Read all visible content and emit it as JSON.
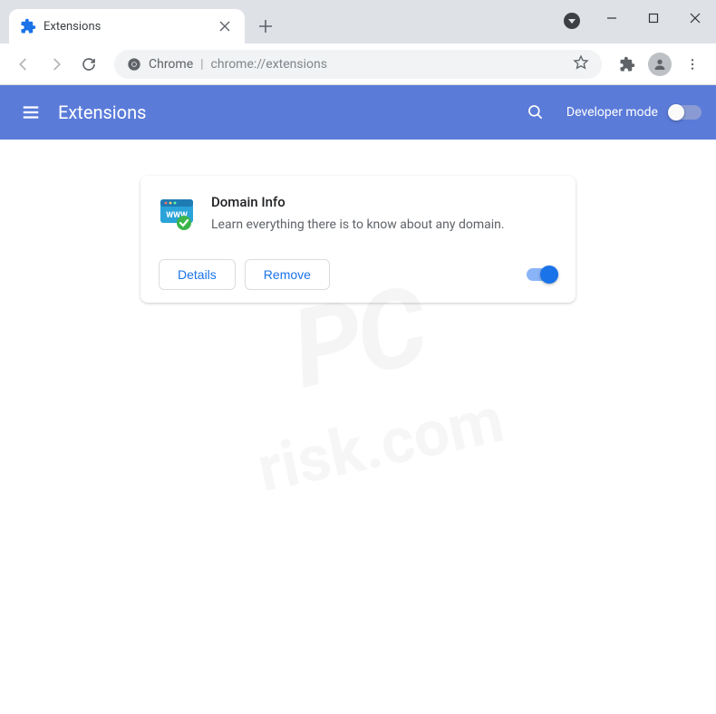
{
  "window": {
    "tab_title": "Extensions"
  },
  "omnibox": {
    "scheme_label": "Chrome",
    "url": "chrome://extensions"
  },
  "header": {
    "title": "Extensions",
    "dev_mode_label": "Developer mode",
    "dev_mode_on": false
  },
  "extension": {
    "name": "Domain Info",
    "description": "Learn everything there is to know about any domain.",
    "details_label": "Details",
    "remove_label": "Remove",
    "enabled": true
  },
  "watermark": {
    "line1": "PC",
    "line2": "risk.com"
  }
}
